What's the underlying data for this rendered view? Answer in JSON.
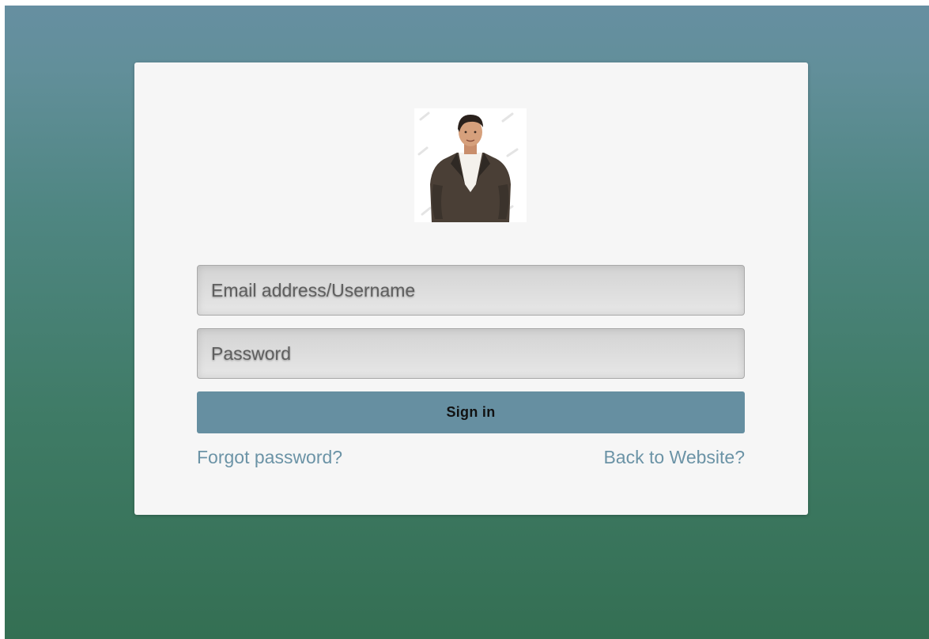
{
  "login": {
    "avatar_icon": "person-in-suit-icon",
    "email_placeholder": "Email address/Username",
    "password_placeholder": "Password",
    "signin_label": "Sign in",
    "forgot_password_label": "Forgot password?",
    "back_to_website_label": "Back to Website?"
  },
  "colors": {
    "background_top": "#668fa1",
    "background_bottom": "#346f53",
    "card": "#f6f6f6",
    "button": "#668fa1",
    "link": "#6b93a6"
  }
}
